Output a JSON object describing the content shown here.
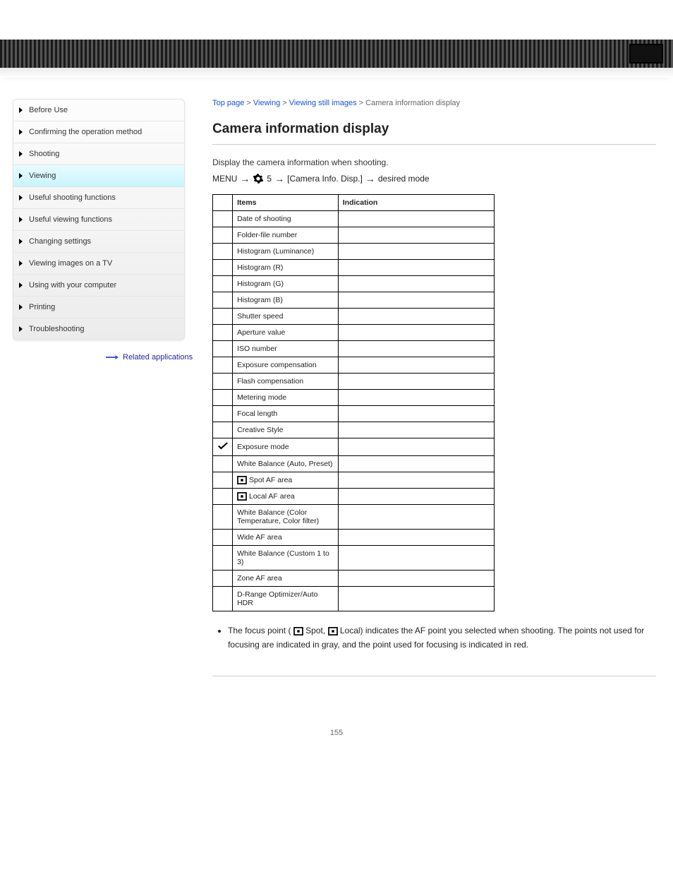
{
  "header": {},
  "sidebar": {
    "items": [
      {
        "label": "Before Use"
      },
      {
        "label": "Confirming the operation method"
      },
      {
        "label": "Shooting"
      },
      {
        "label": "Viewing"
      },
      {
        "label": "Useful shooting functions"
      },
      {
        "label": "Useful viewing functions"
      },
      {
        "label": "Changing settings"
      },
      {
        "label": "Viewing images on a TV"
      },
      {
        "label": "Using with your computer"
      },
      {
        "label": "Printing"
      },
      {
        "label": "Troubleshooting"
      }
    ],
    "active_index": 3,
    "related": "Related applications"
  },
  "breadcrumb": {
    "top": "Top page",
    "sep": ">",
    "cat": "Viewing",
    "sub": "Viewing still images",
    "leaf": "Camera information display"
  },
  "title": "Camera information display",
  "desc": "Display the camera information when shooting.",
  "path": {
    "menu": "MENU",
    "seg1": "5",
    "seg2": "[Camera Info. Disp.]",
    "tail": "desired mode"
  },
  "table": {
    "header": {
      "c1": "",
      "c2": "Items",
      "c3": "Indication"
    },
    "rows": [
      {
        "c1": "",
        "c2": "Date of shooting",
        "c3": ""
      },
      {
        "c1": "",
        "c2": "Folder-file number",
        "c3": ""
      },
      {
        "c1": "",
        "c2": "Histogram (Luminance)",
        "c3": ""
      },
      {
        "c1": "",
        "c2": "Histogram (R)",
        "c3": ""
      },
      {
        "c1": "",
        "c2": "Histogram (G)",
        "c3": ""
      },
      {
        "c1": "",
        "c2": "Histogram (B)",
        "c3": ""
      },
      {
        "c1": "",
        "c2": "Shutter speed",
        "c3": ""
      },
      {
        "c1": "",
        "c2": "Aperture value",
        "c3": ""
      },
      {
        "c1": "",
        "c2": "ISO number",
        "c3": ""
      },
      {
        "c1": "",
        "c2": "Exposure compensation",
        "c3": ""
      },
      {
        "c1": "",
        "c2": "Flash compensation",
        "c3": ""
      },
      {
        "c1": "",
        "c2": "Metering mode",
        "c3": ""
      },
      {
        "c1": "",
        "c2": "Focal length",
        "c3": ""
      },
      {
        "c1": "",
        "c2": "Creative Style",
        "c3": ""
      },
      {
        "c1": "check",
        "c2": "Exposure mode",
        "c3": ""
      },
      {
        "c1": "",
        "c2": "White Balance (Auto, Preset)",
        "c3": ""
      },
      {
        "c1": "af",
        "c2": "Spot AF area",
        "c3": ""
      },
      {
        "c1": "af",
        "c2": "Local AF area",
        "c3": ""
      },
      {
        "c1": "",
        "c2": "White Balance (Color Temperature, Color filter)",
        "c3": ""
      },
      {
        "c1": "",
        "c2": "Wide AF area",
        "c3": ""
      },
      {
        "c1": "",
        "c2": "White Balance (Custom 1 to 3)",
        "c3": ""
      },
      {
        "c1": "",
        "c2": "Zone AF area",
        "c3": ""
      },
      {
        "c1": "",
        "c2": "D-Range Optimizer/Auto HDR",
        "c3": ""
      }
    ]
  },
  "notes": {
    "n1a": "The focus point (",
    "n1b": " Spot, ",
    "n1c": " Local) indicates the AF point you selected when shooting. The points not used for focusing are indicated in gray, and the point used for focusing is indicated in red."
  },
  "page_number": "155"
}
